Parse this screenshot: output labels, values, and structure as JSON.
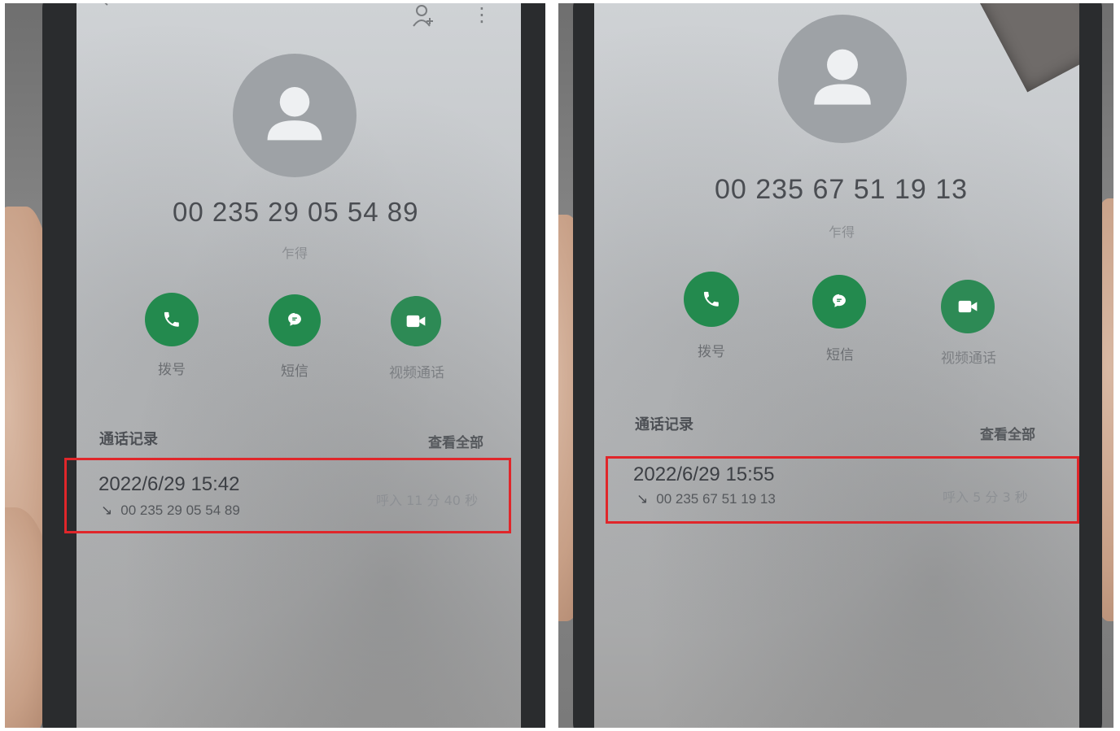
{
  "colors": {
    "action_green": "#238a4e",
    "highlight_red": "#e0262a",
    "screen_gray": "#c4c7ca"
  },
  "left_screen": {
    "top_icons": [
      "back-arrow-icon",
      "add-contact-icon",
      "more-vert-icon"
    ],
    "phone_number": "00 235 29 05 54 89",
    "location": "乍得",
    "actions": [
      {
        "icon": "phone-icon",
        "label": "拨号"
      },
      {
        "icon": "message-icon",
        "label": "短信"
      },
      {
        "icon": "video-call-icon",
        "label": "视频通话"
      }
    ],
    "call_log": {
      "title": "通话记录",
      "view_all": "查看全部",
      "entry": {
        "datetime": "2022/6/29 15:42",
        "direction_icon": "incoming-call-arrow-icon",
        "number": "00 235 29 05 54 89",
        "duration": "呼入  11 分 40 秒"
      }
    }
  },
  "right_screen": {
    "phone_number": "00 235 67 51 19 13",
    "location": "乍得",
    "actions": [
      {
        "icon": "phone-icon",
        "label": "拨号"
      },
      {
        "icon": "message-icon",
        "label": "短信"
      },
      {
        "icon": "video-call-icon",
        "label": "视频通话"
      }
    ],
    "call_log": {
      "title": "通话记录",
      "view_all": "查看全部",
      "entry": {
        "datetime": "2022/6/29 15:55",
        "direction_icon": "incoming-call-arrow-icon",
        "number": "00 235 67 51 19 13",
        "duration": "呼入  5 分 3 秒"
      }
    }
  }
}
